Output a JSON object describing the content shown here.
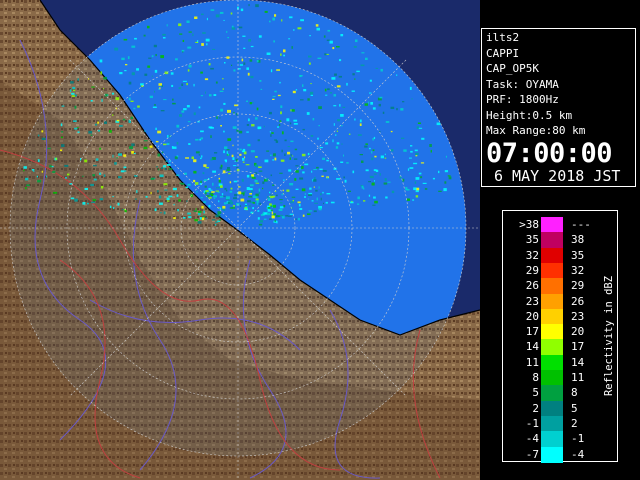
{
  "info": {
    "station": "ilts2",
    "product": "CAPPI",
    "product_code": "CAP_OP5K",
    "task": "Task: OYAMA",
    "prf": "PRF: 1800Hz",
    "height": "Height:0.5 km",
    "max_range": "Max Range:80 km",
    "time": "07:00:00",
    "date": "6 MAY 2018 JST"
  },
  "legend": {
    "unit": "Reflectivity in dBZ",
    "rows": [
      {
        "lo": ">38",
        "hi": "---",
        "color": "#ff20ff"
      },
      {
        "lo": "35",
        "hi": "38",
        "color": "#c00060"
      },
      {
        "lo": "32",
        "hi": "35",
        "color": "#e00000"
      },
      {
        "lo": "29",
        "hi": "32",
        "color": "#ff3000"
      },
      {
        "lo": "26",
        "hi": "29",
        "color": "#ff7000"
      },
      {
        "lo": "23",
        "hi": "26",
        "color": "#ffa000"
      },
      {
        "lo": "20",
        "hi": "23",
        "color": "#ffd000"
      },
      {
        "lo": "17",
        "hi": "20",
        "color": "#ffff00"
      },
      {
        "lo": "14",
        "hi": "17",
        "color": "#90ff00"
      },
      {
        "lo": "11",
        "hi": "14",
        "color": "#00e000"
      },
      {
        "lo": "8",
        "hi": "11",
        "color": "#00c000"
      },
      {
        "lo": "5",
        "hi": "8",
        "color": "#00a040"
      },
      {
        "lo": "2",
        "hi": "5",
        "color": "#008080"
      },
      {
        "lo": "-1",
        "hi": "2",
        "color": "#00a0a0"
      },
      {
        "lo": "-4",
        "hi": "-1",
        "color": "#00d0d0"
      },
      {
        "lo": "-7",
        "hi": "-4",
        "color": "#00ffff"
      }
    ]
  },
  "colors": {
    "sea_covered": "#1f6fe8",
    "land": "#8a6a48",
    "land_dark": "#5a3a22",
    "sea_outer": "#1a2a6a",
    "range_ring": "#cccccc"
  }
}
